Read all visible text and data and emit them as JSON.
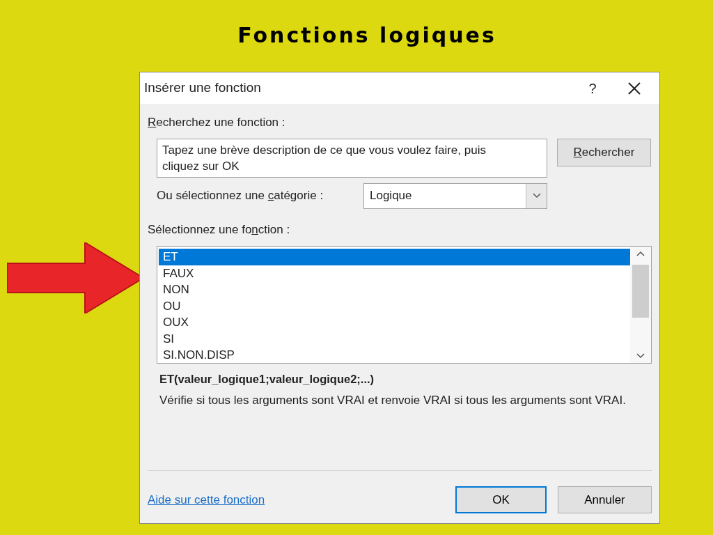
{
  "heading": "Fonctions logiques",
  "dialog": {
    "title": "Insérer une fonction",
    "help": "?",
    "search_label": {
      "key": "R",
      "after": "echerchez une fonction :"
    },
    "search_field": {
      "value": "Tapez une brève description de ce que vous voulez faire, puis cliquez sur OK"
    },
    "search_button": {
      "key": "R",
      "after": "echercher"
    },
    "category_label": {
      "before": "Ou sélectionnez une ",
      "key": "c",
      "after": "atégorie :"
    },
    "category_value": "Logique",
    "function_label": {
      "before": "Sélectionnez une fo",
      "key": "n",
      "after": "ction :"
    },
    "functions": [
      {
        "label": "ET",
        "selected": true
      },
      {
        "label": "FAUX",
        "selected": false
      },
      {
        "label": "NON",
        "selected": false
      },
      {
        "label": "OU",
        "selected": false
      },
      {
        "label": "OUX",
        "selected": false
      },
      {
        "label": "SI",
        "selected": false
      },
      {
        "label": "SI.NON.DISP",
        "selected": false
      }
    ],
    "signature": "ET(valeur_logique1;valeur_logique2;...)",
    "description": "Vérifie si tous les arguments sont VRAI et renvoie VRAI si tous les arguments sont VRAI.",
    "help_link": "Aide sur cette fonction",
    "buttons": [
      {
        "label": "OK",
        "default": true
      },
      {
        "label": "Annuler",
        "default": false
      }
    ]
  }
}
